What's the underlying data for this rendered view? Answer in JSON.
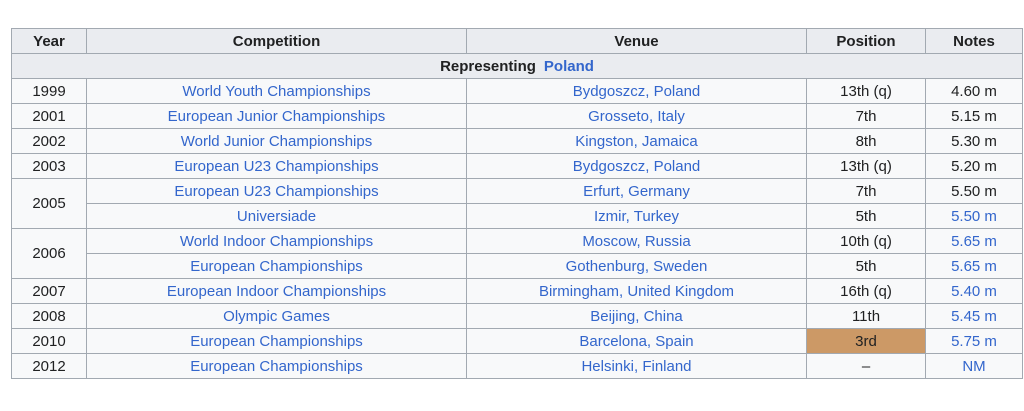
{
  "headers": {
    "year": "Year",
    "competition": "Competition",
    "venue": "Venue",
    "position": "Position",
    "notes": "Notes"
  },
  "representing": {
    "label": "Representing",
    "country": "Poland"
  },
  "colors": {
    "link": "#3366cc",
    "header_bg": "#eaecf0",
    "cell_bg": "#f8f9fa",
    "border": "#a2a9b1",
    "bronze": "#cc9966"
  },
  "rows": [
    {
      "year": "1999",
      "competition": "World Youth Championships",
      "venue": "Bydgoszcz, Poland",
      "position": "13th (q)",
      "notes": "4.60 m"
    },
    {
      "year": "2001",
      "competition": "European Junior Championships",
      "venue": "Grosseto, Italy",
      "position": "7th",
      "notes": "5.15 m"
    },
    {
      "year": "2002",
      "competition": "World Junior Championships",
      "venue": "Kingston, Jamaica",
      "position": "8th",
      "notes": "5.30 m"
    },
    {
      "year": "2003",
      "competition": "European U23 Championships",
      "venue": "Bydgoszcz, Poland",
      "position": "13th (q)",
      "notes": "5.20 m"
    },
    {
      "year": "2005",
      "competition": "European U23 Championships",
      "venue": "Erfurt, Germany",
      "position": "7th",
      "notes": "5.50 m"
    },
    {
      "year": "",
      "competition": "Universiade",
      "venue": "Izmir, Turkey",
      "position": "5th",
      "notes": "5.50 m"
    },
    {
      "year": "2006",
      "competition": "World Indoor Championships",
      "venue": "Moscow, Russia",
      "position": "10th (q)",
      "notes": "5.65 m"
    },
    {
      "year": "",
      "competition": "European Championships",
      "venue": "Gothenburg, Sweden",
      "position": "5th",
      "notes": "5.65 m"
    },
    {
      "year": "2007",
      "competition": "European Indoor Championships",
      "venue": "Birmingham, United Kingdom",
      "position": "16th (q)",
      "notes": "5.40 m"
    },
    {
      "year": "2008",
      "competition": "Olympic Games",
      "venue": "Beijing, China",
      "position": "11th",
      "notes": "5.45 m"
    },
    {
      "year": "2010",
      "competition": "European Championships",
      "venue": "Barcelona, Spain",
      "position": "3rd",
      "notes": "5.75 m"
    },
    {
      "year": "2012",
      "competition": "European Championships",
      "venue": "Helsinki, Finland",
      "position": "–",
      "notes": "NM"
    }
  ]
}
